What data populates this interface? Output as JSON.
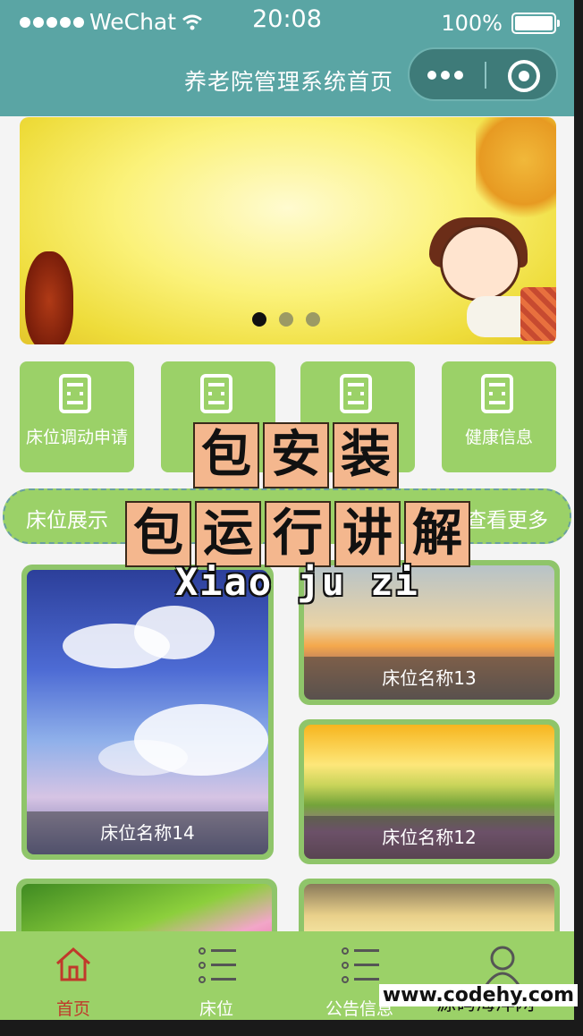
{
  "status_bar": {
    "carrier": "WeChat",
    "time": "20:08",
    "battery": "100%"
  },
  "navbar": {
    "title": "养老院管理系统首页"
  },
  "banner": {
    "page_count": 3,
    "active_index": 0
  },
  "grid": {
    "items": [
      {
        "label": "床位调动申请",
        "icon": "document-icon"
      },
      {
        "label": "",
        "icon": "document-icon"
      },
      {
        "label": "",
        "icon": "document-icon"
      },
      {
        "label": "健康信息",
        "icon": "document-icon"
      }
    ]
  },
  "section": {
    "title": "床位展示",
    "more": "查看更多"
  },
  "beds": [
    {
      "name": "床位名称14"
    },
    {
      "name": "床位名称13"
    },
    {
      "name": "床位名称12"
    }
  ],
  "tabbar": {
    "items": [
      {
        "label": "首页",
        "icon": "home-icon",
        "active": true
      },
      {
        "label": "床位",
        "icon": "list-icon",
        "active": false
      },
      {
        "label": "公告信息",
        "icon": "list-icon",
        "active": false
      },
      {
        "label": "",
        "icon": "user-icon",
        "active": false
      }
    ]
  },
  "watermark": {
    "line1": [
      "包",
      "安",
      "装"
    ],
    "line2": [
      "包",
      "运",
      "行",
      "讲",
      "解"
    ],
    "line3": "Xiao ju zi",
    "site_name": "源码海洋网",
    "site_url": "www.codehy.com"
  },
  "colors": {
    "header": "#5aa5a4",
    "accent_green": "#9bd168",
    "active_tab": "#c0392b"
  }
}
